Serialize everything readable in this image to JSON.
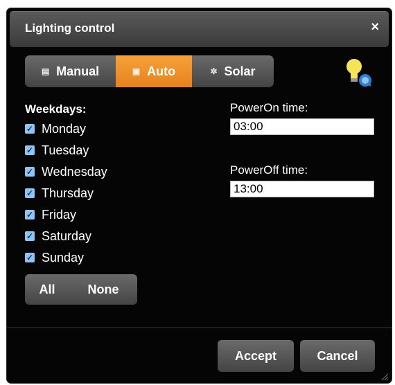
{
  "dialog": {
    "title": "Lighting control",
    "close_glyph": "×"
  },
  "modes": [
    {
      "label": "Manual",
      "icon": "manual-icon",
      "active": false
    },
    {
      "label": "Auto",
      "icon": "calendar-icon",
      "active": true
    },
    {
      "label": "Solar",
      "icon": "sun-icon",
      "active": false
    }
  ],
  "weekdays": {
    "label": "Weekdays:",
    "days": [
      {
        "label": "Monday",
        "checked": true
      },
      {
        "label": "Tuesday",
        "checked": true
      },
      {
        "label": "Wednesday",
        "checked": true
      },
      {
        "label": "Thursday",
        "checked": true
      },
      {
        "label": "Friday",
        "checked": true
      },
      {
        "label": "Saturday",
        "checked": true
      },
      {
        "label": "Sunday",
        "checked": true
      }
    ]
  },
  "selection": {
    "all_label": "All",
    "none_label": "None"
  },
  "power_on": {
    "label": "PowerOn time:",
    "value": "03:00"
  },
  "power_off": {
    "label": "PowerOff time:",
    "value": "13:00"
  },
  "footer": {
    "accept_label": "Accept",
    "cancel_label": "Cancel"
  },
  "colors": {
    "accent": "#f0952a",
    "background": "#050505",
    "button": "#555555",
    "checkbox": "#8fc4f0"
  }
}
